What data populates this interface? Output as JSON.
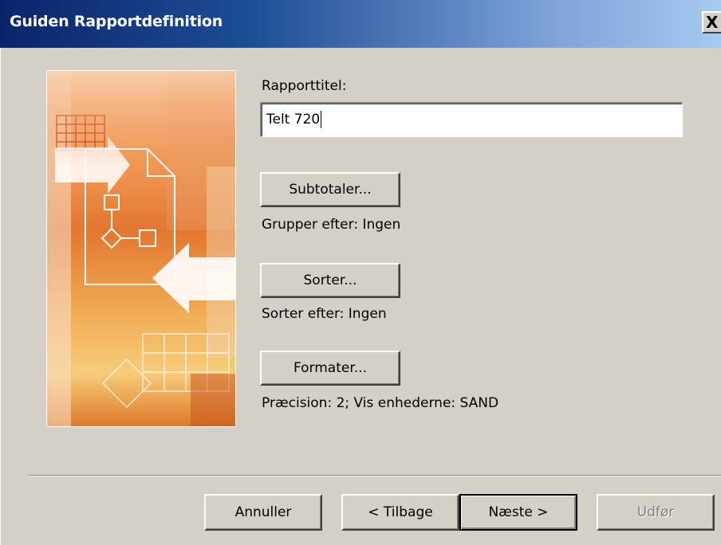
{
  "window": {
    "title": "Guiden Rapportdefinition",
    "close_label": "X"
  },
  "form": {
    "report_title_label": "Rapporttitel:",
    "report_title_value": "Telt 720",
    "subtotals_button": "Subtotaler...",
    "group_by_text": "Grupper efter: Ingen",
    "sort_button": "Sorter...",
    "sort_by_text": "Sorter efter: Ingen",
    "format_button": "Formater...",
    "format_text": "Præcision: 2;  Vis enhederne: SAND"
  },
  "footer": {
    "cancel": "Annuller",
    "back": "< Tilbage",
    "next": "Næste >",
    "finish": "Udfør"
  },
  "colors": {
    "titlebar_start": "#0a246a",
    "titlebar_end": "#a6caf0",
    "dialog_bg": "#d4d0c8",
    "disabled_text": "#808080"
  },
  "icons": {
    "close": "close-icon",
    "wizard_art": "report-wizard-illustration"
  }
}
